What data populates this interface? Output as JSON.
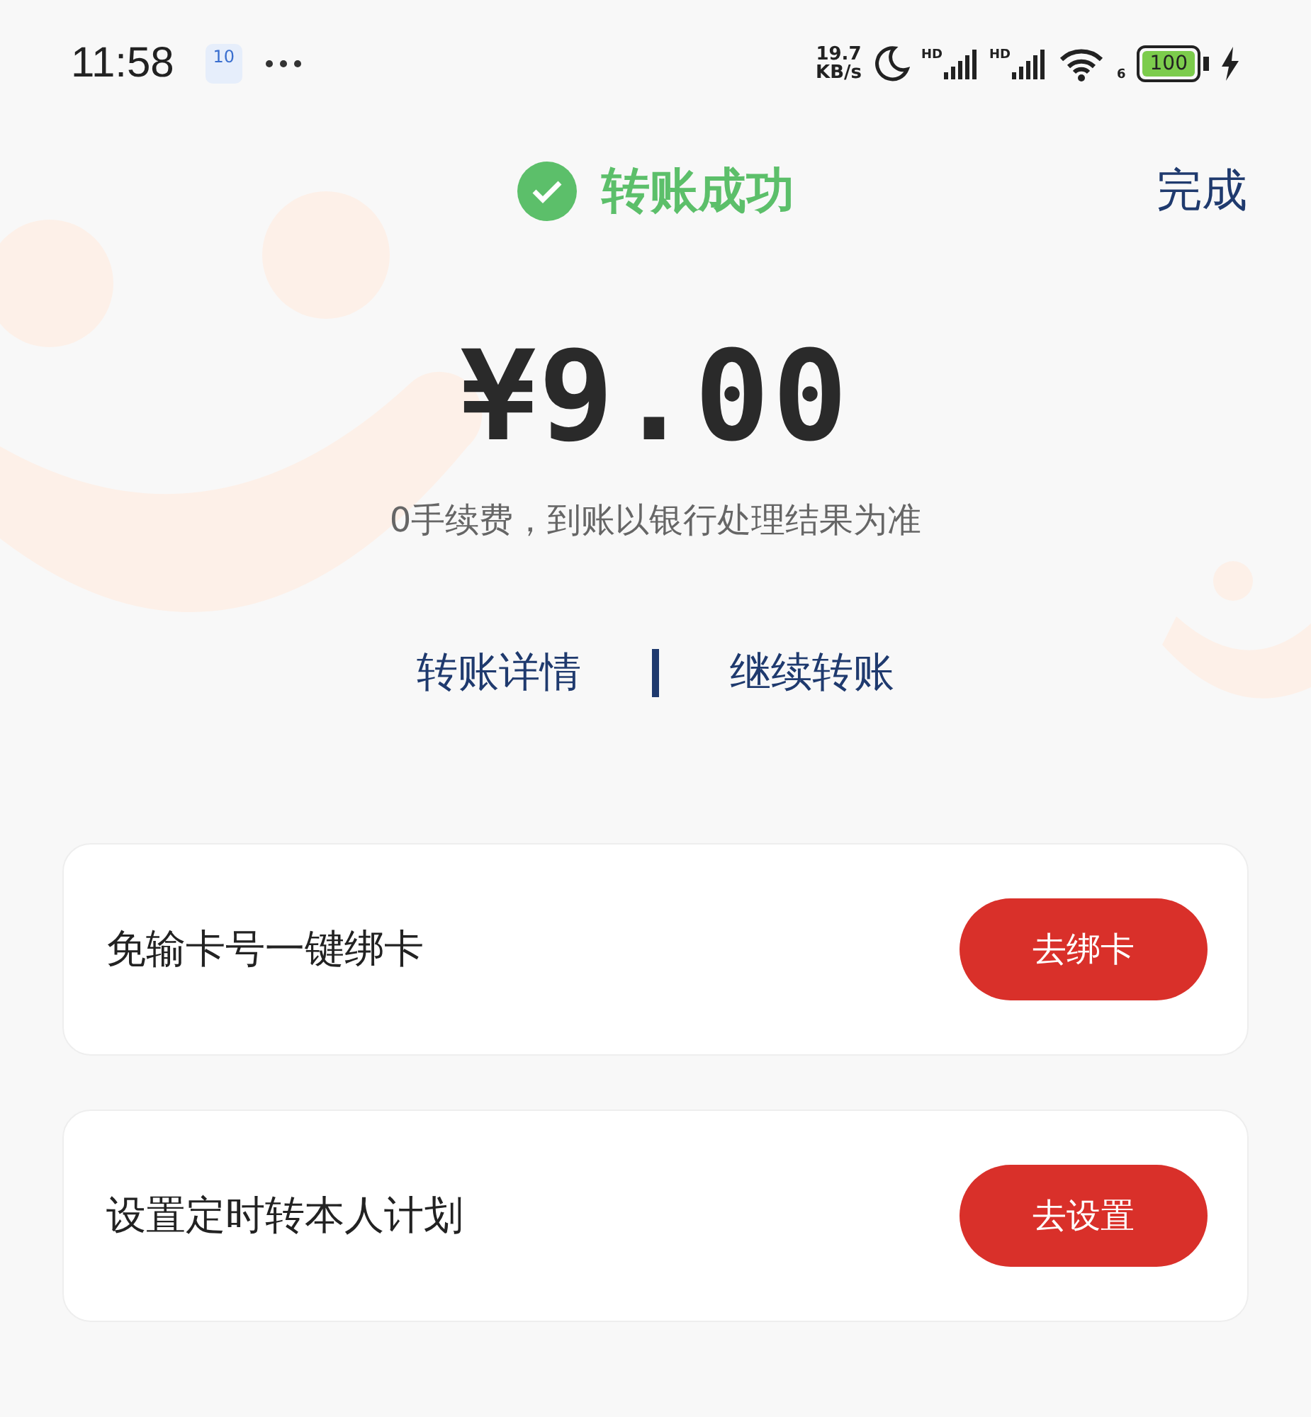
{
  "status_bar": {
    "time": "11:58",
    "date_badge": "10",
    "net_speed": "19.7",
    "net_unit": "KB/s",
    "signal_labels": [
      "HD",
      "HD"
    ],
    "wifi_label": "6",
    "battery": "100"
  },
  "header": {
    "title": "转账成功",
    "done": "完成"
  },
  "amount": "¥9.00",
  "note": "0手续费，到账以银行处理结果为准",
  "links": [
    "转账详情",
    "继续转账"
  ],
  "cards": [
    {
      "title": "免输卡号一键绑卡",
      "button": "去绑卡"
    },
    {
      "title": "设置定时转本人计划",
      "button": "去设置"
    }
  ]
}
